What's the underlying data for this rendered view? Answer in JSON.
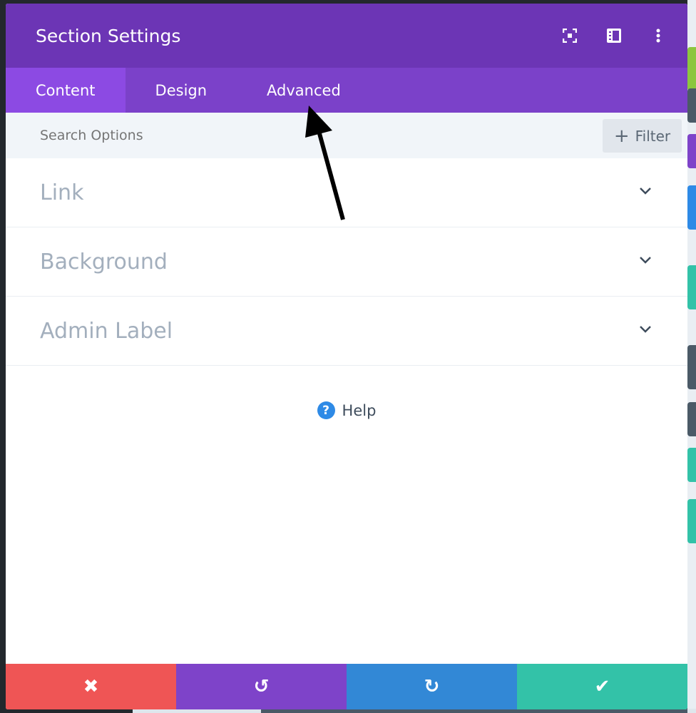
{
  "modal": {
    "title": "Section Settings",
    "header_icons": [
      "fullscreen-icon",
      "split-view-icon",
      "more-vertical-icon"
    ],
    "tabs": [
      {
        "label": "Content",
        "active": true
      },
      {
        "label": "Design"
      },
      {
        "label": "Advanced"
      }
    ],
    "search": {
      "placeholder": "Search Options"
    },
    "filter_label": "Filter",
    "sections": [
      {
        "label": "Link"
      },
      {
        "label": "Background"
      },
      {
        "label": "Admin Label"
      }
    ],
    "help_label": "Help",
    "footer": [
      {
        "icon": "close-icon",
        "glyph": "✖",
        "color": "#ef5555"
      },
      {
        "icon": "undo-icon",
        "glyph": "↺",
        "color": "#7e43c9"
      },
      {
        "icon": "redo-icon",
        "glyph": "↻",
        "color": "#3288d6"
      },
      {
        "icon": "check-icon",
        "glyph": "✔",
        "color": "#33c2a8"
      }
    ]
  },
  "colors": {
    "header": "#6c35b5",
    "tabs": "#7b41c9",
    "active_tab": "#8c4ae3"
  }
}
